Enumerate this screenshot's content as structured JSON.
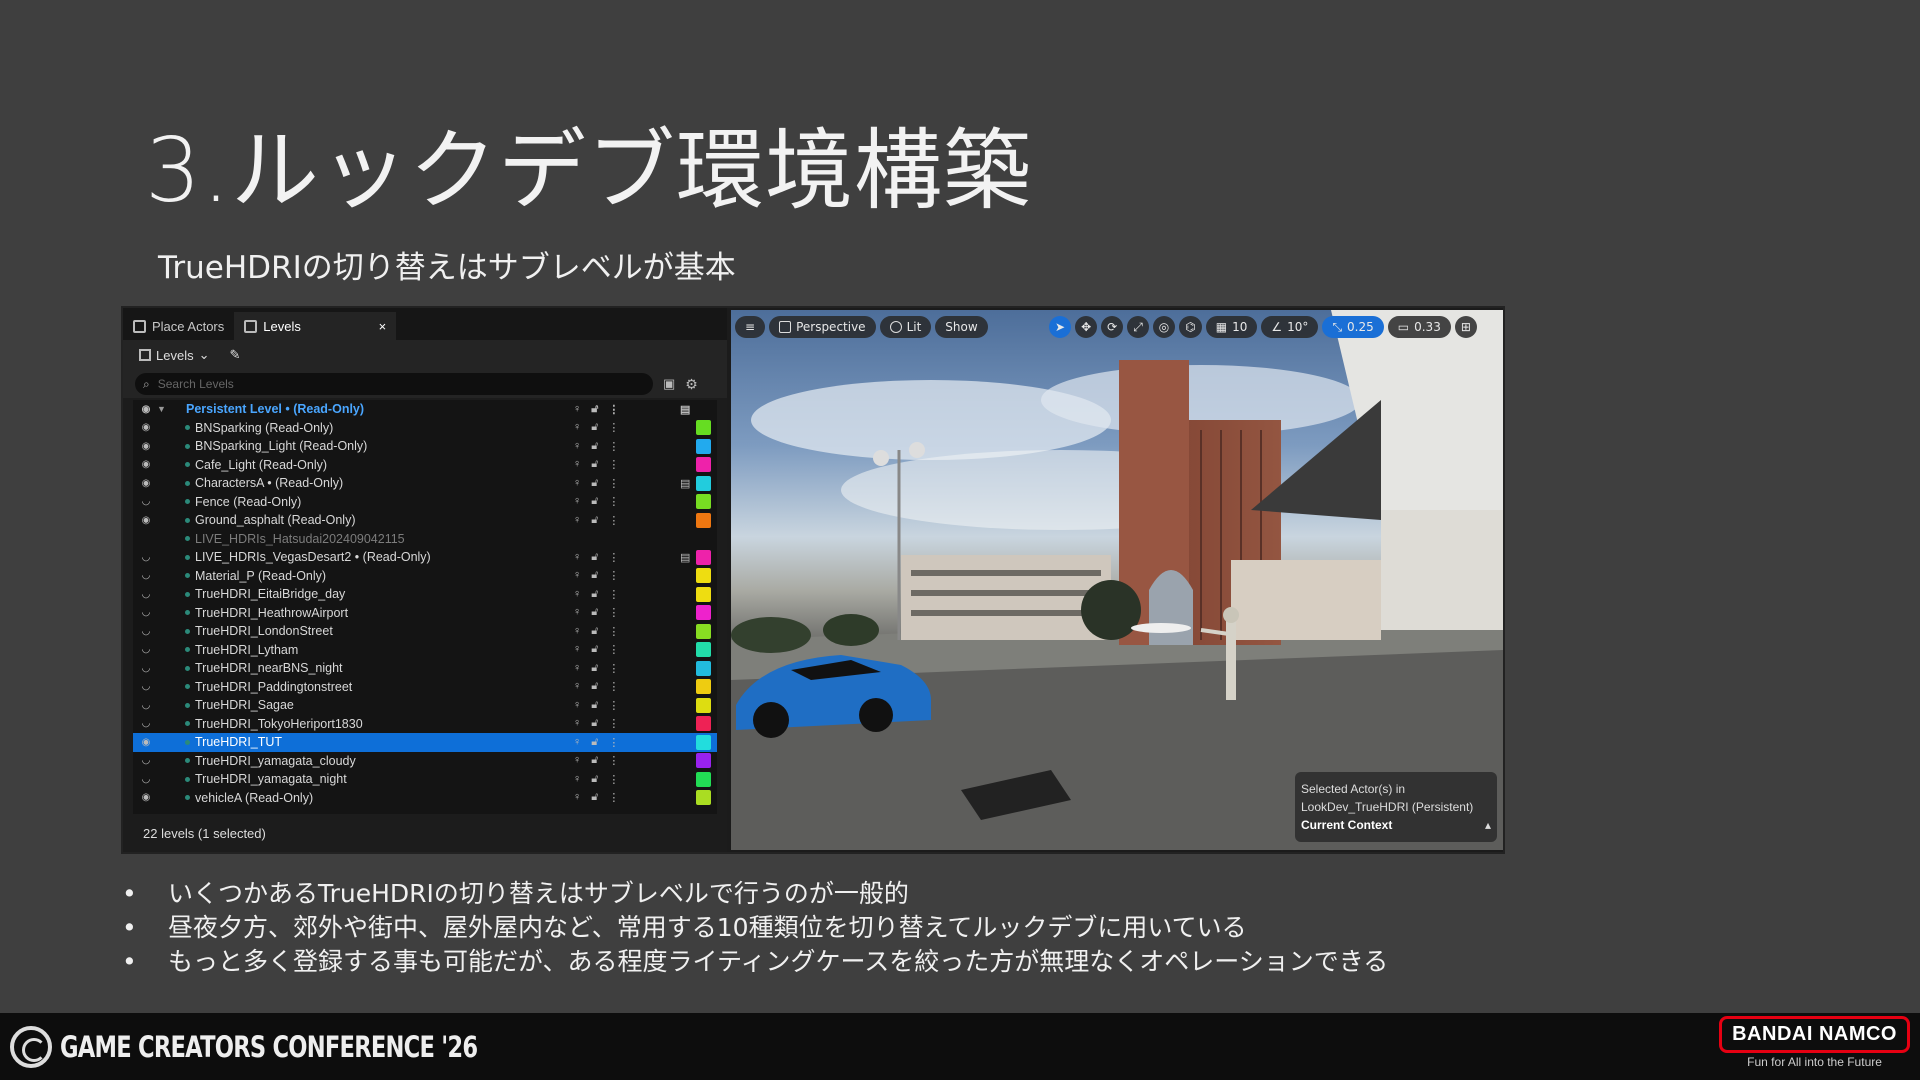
{
  "slide": {
    "title": "3.ルックデブ環境構築",
    "subtitle": "TrueHDRIの切り替えはサブレベルが基本",
    "bullets": [
      "いくつかあるTrueHDRIの切り替えはサブレベルで行うのが一般的",
      "昼夜夕方、郊外や街中、屋外屋内など、常用する10種類位を切り替えてルックデブに用いている",
      "もっと多く登録する事も可能だが、ある程度ライティングケースを絞った方が無理なくオペレーションできる"
    ]
  },
  "panel": {
    "tabs": [
      {
        "label": "Place Actors"
      },
      {
        "label": "Levels",
        "close": "×"
      }
    ],
    "toolbar_label": "Levels",
    "search_placeholder": "Search Levels",
    "status": "22 levels (1 selected)",
    "levels": [
      {
        "name": "Persistent Level • (Read-Only)",
        "color": "",
        "visible": true
      },
      {
        "name": "BNSparking (Read-Only)",
        "color": "#66dd22",
        "visible": true
      },
      {
        "name": "BNSparking_Light (Read-Only)",
        "color": "#22aaee",
        "visible": true
      },
      {
        "name": "Cafe_Light (Read-Only)",
        "color": "#ee22aa",
        "visible": true
      },
      {
        "name": "CharactersA • (Read-Only)",
        "color": "#22ccdd",
        "visible": true
      },
      {
        "name": "Fence (Read-Only)",
        "color": "#77dd22",
        "visible": false
      },
      {
        "name": "Ground_asphalt (Read-Only)",
        "color": "#ee7711",
        "visible": true
      },
      {
        "name": "LIVE_HDRIs_Hatsudai202409042115",
        "color": "",
        "visible": false
      },
      {
        "name": "LIVE_HDRIs_VegasDesart2 • (Read-Only)",
        "color": "#ee22aa",
        "visible": false
      },
      {
        "name": "Material_P (Read-Only)",
        "color": "#eedd11",
        "visible": false
      },
      {
        "name": "TrueHDRI_EitaiBridge_day",
        "color": "#eedd11",
        "visible": false
      },
      {
        "name": "TrueHDRI_HeathrowAirport",
        "color": "#ee22cc",
        "visible": false
      },
      {
        "name": "TrueHDRI_LondonStreet",
        "color": "#88dd22",
        "visible": false
      },
      {
        "name": "TrueHDRI_Lytham",
        "color": "#22ddaa",
        "visible": false
      },
      {
        "name": "TrueHDRI_nearBNS_night",
        "color": "#22bbdd",
        "visible": false
      },
      {
        "name": "TrueHDRI_Paddingtonstreet",
        "color": "#eecc11",
        "visible": false
      },
      {
        "name": "TrueHDRI_Sagae",
        "color": "#dddd11",
        "visible": false
      },
      {
        "name": "TrueHDRI_TokyoHeriport1830",
        "color": "#ee2255",
        "visible": false
      },
      {
        "name": "TrueHDRI_TUT",
        "color": "#22dddd",
        "visible": true
      },
      {
        "name": "TrueHDRI_yamagata_cloudy",
        "color": "#9922ee",
        "visible": false
      },
      {
        "name": "TrueHDRI_yamagata_night",
        "color": "#22dd55",
        "visible": false
      },
      {
        "name": "vehicleA (Read-Only)",
        "color": "#aadd22",
        "visible": true
      }
    ]
  },
  "viewport": {
    "perspective": "Perspective",
    "lit": "Lit",
    "show": "Show",
    "grid": "10",
    "angle": "10°",
    "scale": "0.25",
    "camera": "0.33",
    "context_line1": "Selected Actor(s) in",
    "context_line2": "LookDev_TrueHDRI (Persistent)",
    "context_title": "Current Context"
  },
  "footer": {
    "conference": "GAME CREATORS CONFERENCE '26",
    "brand": "BANDAI NAMCO",
    "tagline": "Fun for All into the Future"
  }
}
